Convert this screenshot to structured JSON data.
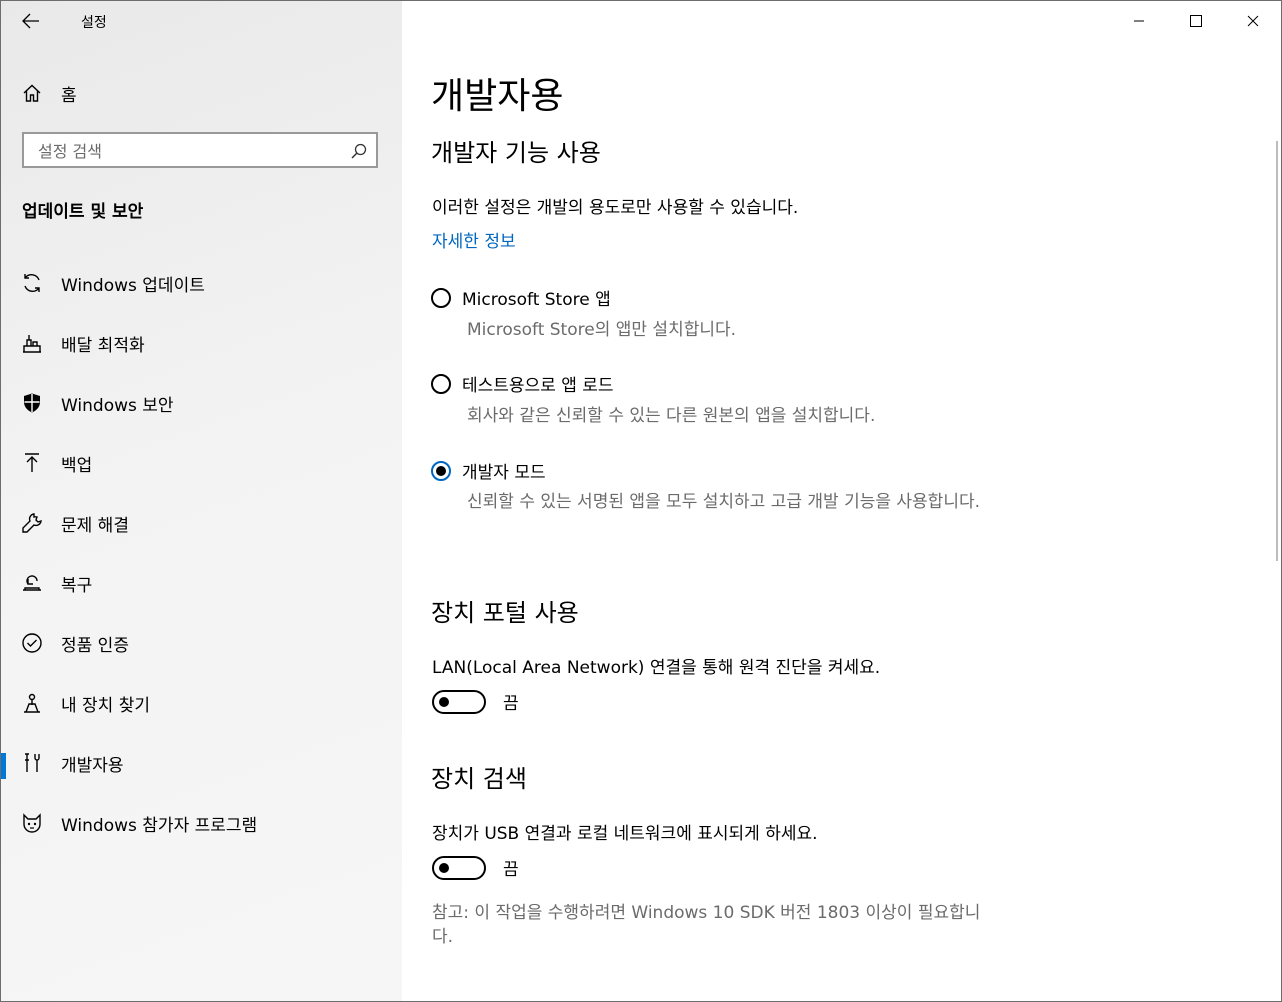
{
  "window": {
    "title": "설정"
  },
  "sidebar": {
    "home_label": "홈",
    "search_placeholder": "설정 검색",
    "section_header": "업데이트 및 보안",
    "items": [
      {
        "label": "Windows 업데이트",
        "icon": "refresh-icon"
      },
      {
        "label": "배달 최적화",
        "icon": "delivery-optimization-icon"
      },
      {
        "label": "Windows 보안",
        "icon": "shield-icon"
      },
      {
        "label": "백업",
        "icon": "backup-arrow-icon"
      },
      {
        "label": "문제 해결",
        "icon": "wrench-icon"
      },
      {
        "label": "복구",
        "icon": "recovery-icon"
      },
      {
        "label": "정품 인증",
        "icon": "check-circle-icon"
      },
      {
        "label": "내 장치 찾기",
        "icon": "find-device-icon"
      },
      {
        "label": "개발자용",
        "icon": "developer-tools-icon",
        "active": true
      },
      {
        "label": "Windows 참가자 프로그램",
        "icon": "insider-cat-icon"
      }
    ]
  },
  "main": {
    "title": "개발자용",
    "dev_features": {
      "heading": "개발자 기능 사용",
      "description": "이러한 설정은 개발의 용도로만 사용할 수 있습니다.",
      "link": "자세한 정보",
      "options": [
        {
          "label": "Microsoft Store 앱",
          "description": "Microsoft Store의 앱만 설치합니다.",
          "selected": false
        },
        {
          "label": "테스트용으로 앱 로드",
          "description": "회사와 같은 신뢰할 수 있는 다른 원본의 앱을 설치합니다.",
          "selected": false
        },
        {
          "label": "개발자 모드",
          "description": "신뢰할 수 있는 서명된 앱을 모두 설치하고 고급 개발 기능을 사용합니다.",
          "selected": true
        }
      ]
    },
    "device_portal": {
      "heading": "장치 포털 사용",
      "description": "LAN(Local Area Network) 연결을 통해 원격 진단을 켜세요.",
      "toggle_state": "끔"
    },
    "device_discovery": {
      "heading": "장치 검색",
      "description": "장치가 USB 연결과 로컬 네트워크에 표시되게 하세요.",
      "toggle_state": "끔",
      "note": "참고: 이 작업을 수행하려면 Windows 10 SDK 버전 1803 이상이 필요합니다."
    }
  },
  "colors": {
    "accent": "#0078d7",
    "link": "#0067c0",
    "secondary_text": "#6b6b6b"
  }
}
